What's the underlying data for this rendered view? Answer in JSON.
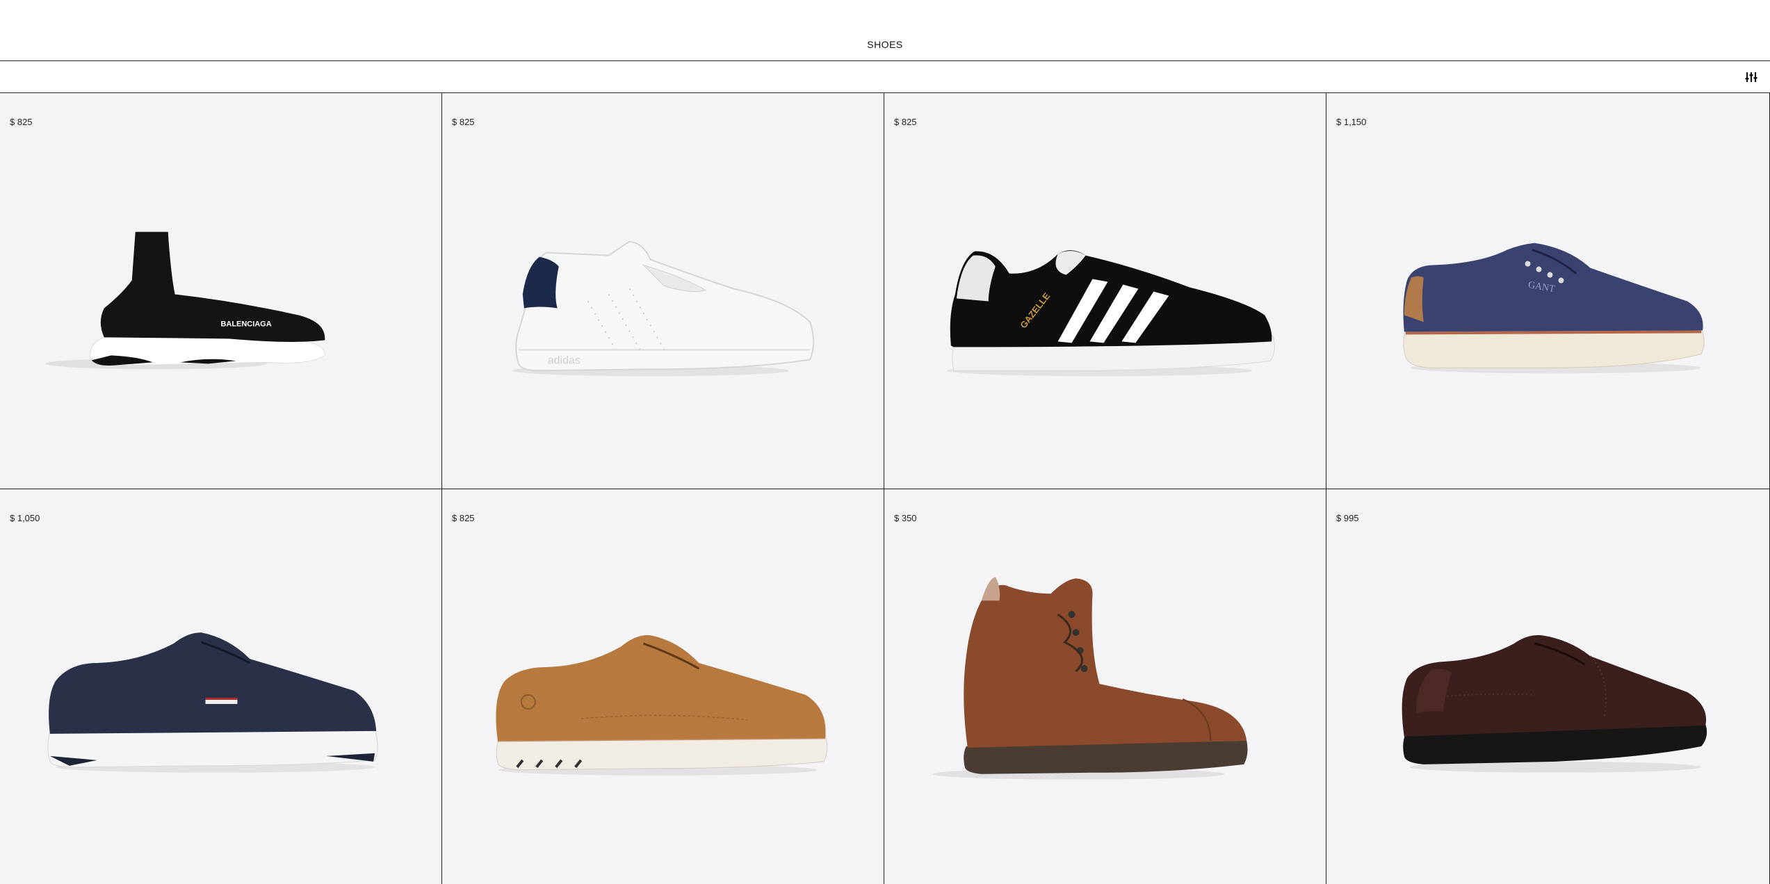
{
  "header": {
    "title": "SHOES"
  },
  "toolbar": {
    "filter_icon": "sliders-icon"
  },
  "products": [
    {
      "price": "$ 825",
      "icon": "sock-sneaker-icon",
      "brand_mark": "BALENCIAGA",
      "colors": {
        "upper": "#141414",
        "sole": "#ffffff"
      }
    },
    {
      "price": "$ 825",
      "icon": "white-sneaker-icon",
      "brand_mark": "adidas",
      "colors": {
        "upper": "#f7f7f7",
        "heel": "#1b2a4a"
      }
    },
    {
      "price": "$ 825",
      "icon": "suede-sneaker-icon",
      "brand_mark": "GAZELLE",
      "colors": {
        "upper": "#0e0e0e",
        "stripes": "#ffffff",
        "sole": "#f2f2f2"
      }
    },
    {
      "price": "$ 1,150",
      "icon": "canvas-sneaker-icon",
      "brand_mark": "GANT",
      "colors": {
        "upper": "#3a4270",
        "sole": "#efe9d9"
      }
    },
    {
      "price": "$ 1,050",
      "icon": "leather-sneaker-icon",
      "colors": {
        "upper": "#2a3047",
        "sole": "#f5f5f5"
      }
    },
    {
      "price": "$ 825",
      "icon": "derby-shoe-icon",
      "colors": {
        "upper": "#b7793e",
        "sole": "#f1ece4"
      }
    },
    {
      "price": "$ 350",
      "icon": "lace-boot-icon",
      "colors": {
        "upper": "#8a4a2b",
        "sole": "#4a3c33"
      }
    },
    {
      "price": "$ 995",
      "icon": "brogue-shoe-icon",
      "colors": {
        "upper": "#3a1f1c",
        "sole": "#161616"
      }
    }
  ]
}
